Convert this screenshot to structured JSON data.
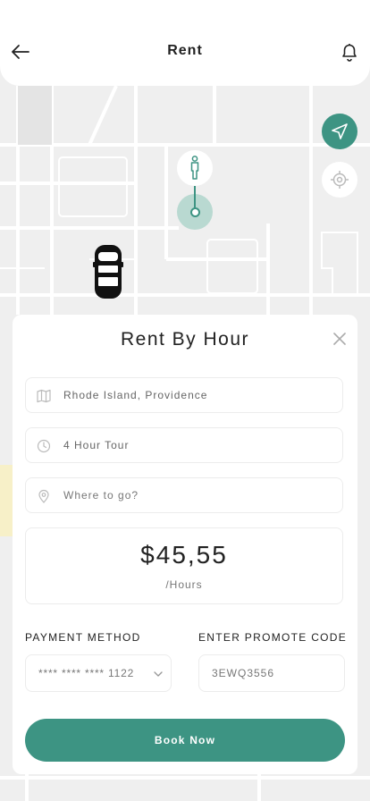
{
  "header": {
    "title": "Rent"
  },
  "sheet": {
    "title": "Rent By Hour",
    "pickup_value": "Rhode Island, Providence",
    "tour_value": "4 Hour Tour",
    "destination_placeholder": "Where to go?",
    "price": "$45,55",
    "price_unit": "/Hours",
    "payment_label": "PAYMENT METHOD",
    "payment_value": "**** **** **** 1122",
    "promo_label": "ENTER PROMOTE CODE",
    "promo_value": "3EWQ3556",
    "book_label": "Book Now"
  },
  "icons": {
    "back": "arrow-left-icon",
    "notifications": "bell-icon",
    "navigate": "navigation-arrow-icon",
    "locate": "crosshair-icon",
    "pickup": "map-icon",
    "duration": "clock-icon",
    "destination": "pin-icon",
    "close": "close-icon"
  },
  "colors": {
    "accent": "#3d9483",
    "accent_light": "#b9d9d1",
    "map_bg": "#efefef"
  }
}
